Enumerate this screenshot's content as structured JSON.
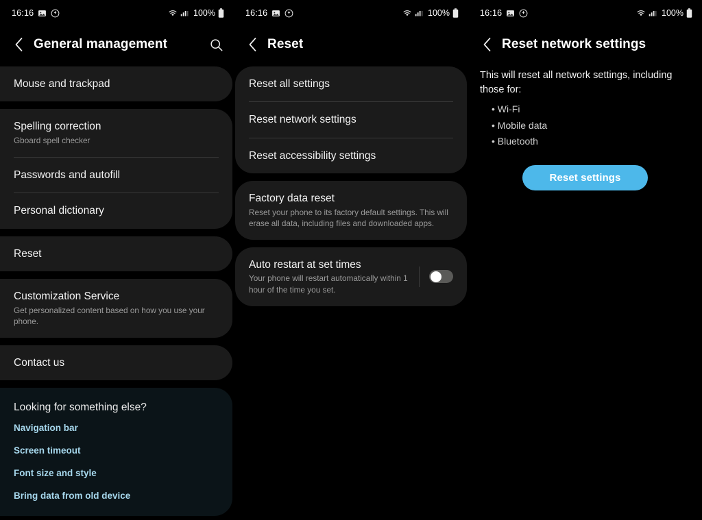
{
  "status_bar": {
    "time": "16:16",
    "battery_percent": "100%",
    "icons": [
      "gallery-icon",
      "do-not-disturb-icon",
      "wifi-icon",
      "cellular-signal-icon",
      "battery-icon"
    ]
  },
  "colors": {
    "background": "#000000",
    "card": "#1b1b1b",
    "suggestion_card": "#0b1418",
    "accent_blue": "#4db8ea",
    "link_blue": "#a6d7ec",
    "divider": "#3a3a3a",
    "primary_text": "#f2f2f2",
    "secondary_text": "#9a9a9a"
  },
  "screen1": {
    "title": "General management",
    "back_label": "Back",
    "search_label": "Search",
    "groups": [
      {
        "items": [
          {
            "title": "Mouse and trackpad",
            "sub": ""
          }
        ]
      },
      {
        "items": [
          {
            "title": "Spelling correction",
            "sub": "Gboard spell checker"
          },
          {
            "title": "Passwords and autofill",
            "sub": ""
          },
          {
            "title": "Personal dictionary",
            "sub": ""
          }
        ]
      },
      {
        "items": [
          {
            "title": "Reset",
            "sub": ""
          }
        ]
      },
      {
        "items": [
          {
            "title": "Customization Service",
            "sub": "Get personalized content based on how you use your phone."
          }
        ]
      },
      {
        "items": [
          {
            "title": "Contact us",
            "sub": ""
          }
        ]
      }
    ],
    "suggestions": {
      "heading": "Looking for something else?",
      "links": [
        "Navigation bar",
        "Screen timeout",
        "Font size and style",
        "Bring data from old device"
      ]
    }
  },
  "screen2": {
    "title": "Reset",
    "back_label": "Back",
    "group1": [
      {
        "title": "Reset all settings"
      },
      {
        "title": "Reset network settings"
      },
      {
        "title": "Reset accessibility settings"
      }
    ],
    "group2": [
      {
        "title": "Factory data reset",
        "sub": "Reset your phone to its factory default settings. This will erase all data, including files and downloaded apps."
      }
    ],
    "group3": [
      {
        "title": "Auto restart at set times",
        "sub": "Your phone will restart automatically within 1 hour of the time you set.",
        "toggle_state": "off"
      }
    ]
  },
  "screen3": {
    "title": "Reset network settings",
    "back_label": "Back",
    "description": "This will reset all network settings, including those for:",
    "bullets": [
      "Wi-Fi",
      "Mobile data",
      "Bluetooth"
    ],
    "button_label": "Reset settings"
  }
}
